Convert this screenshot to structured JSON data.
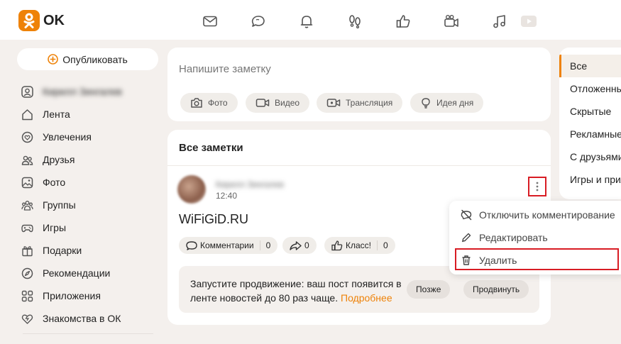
{
  "header": {
    "logo_text": "OK",
    "brand_color": "#ee8208",
    "icons": [
      "mail-icon",
      "chat-icon",
      "bell-icon",
      "guests-footprints-icon",
      "like-icon",
      "video-camera-icon",
      "music-icon",
      "video-play-icon"
    ]
  },
  "sidebar": {
    "publish_label": "Опубликовать",
    "profile_name": "Кирилл Зингалев",
    "items": [
      {
        "label": "Лента",
        "icon": "home-icon"
      },
      {
        "label": "Увлечения",
        "icon": "hobby-icon"
      },
      {
        "label": "Друзья",
        "icon": "friends-icon"
      },
      {
        "label": "Фото",
        "icon": "photo-icon"
      },
      {
        "label": "Группы",
        "icon": "groups-icon"
      },
      {
        "label": "Игры",
        "icon": "gamepad-icon"
      },
      {
        "label": "Подарки",
        "icon": "gift-icon"
      },
      {
        "label": "Рекомендации",
        "icon": "compass-icon"
      },
      {
        "label": "Приложения",
        "icon": "apps-grid-icon"
      },
      {
        "label": "Знакомства в ОК",
        "icon": "dating-heart-icon"
      }
    ]
  },
  "composer": {
    "placeholder": "Напишите заметку",
    "chips": [
      "Фото",
      "Видео",
      "Трансляция",
      "Идея дня"
    ]
  },
  "notes": {
    "title": "Все заметки",
    "post": {
      "author": "Кирилл Зингалев",
      "time": "12:40",
      "text": "WiFiGiD.RU",
      "comments_label": "Комментарии",
      "comments_count": "0",
      "shares_count": "0",
      "likes_label": "Класс!",
      "likes_count": "0"
    },
    "promo": {
      "text": "Запустите продвижение: ваш пост появится в ленте новостей до 80 раз чаще.",
      "link": "Подробнее",
      "later_label": "Позже",
      "promote_label": "Продвинуть"
    }
  },
  "filters": {
    "items": [
      "Все",
      "Отложенные",
      "Скрытые",
      "Рекламные",
      "С друзьями",
      "Игры и приложения"
    ],
    "active_index": 0
  },
  "context_menu": {
    "items": [
      {
        "label": "Отключить комментирование",
        "icon": "comments-off-icon"
      },
      {
        "label": "Редактировать",
        "icon": "pencil-icon"
      },
      {
        "label": "Удалить",
        "icon": "trash-icon"
      }
    ]
  }
}
